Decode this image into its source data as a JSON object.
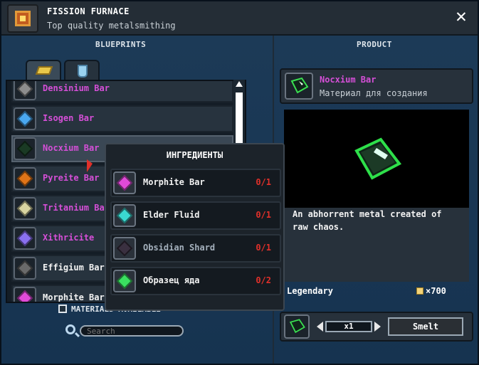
{
  "window": {
    "title": "FISSION FURNACE",
    "subtitle": "Top quality metalsmithing",
    "close_icon": "close-icon"
  },
  "sections": {
    "blueprints": "BLUEPRINTS",
    "product": "PRODUCT"
  },
  "tabs": [
    {
      "icon": "ingot-icon",
      "active": true
    },
    {
      "icon": "flask-icon",
      "active": false
    }
  ],
  "blueprints": [
    {
      "label": "Densinium Bar",
      "color": "#d64fd8",
      "gem": "#8d8d8d"
    },
    {
      "label": "Isogen Bar",
      "color": "#d64fd8",
      "gem": "#4aa8f0"
    },
    {
      "label": "Nocxium Bar",
      "color": "#d64fd8",
      "gem": "#1a3a24",
      "selected": true
    },
    {
      "label": "Pyreite Bar",
      "color": "#d64fd8",
      "gem": "#e07418"
    },
    {
      "label": "Tritanium Bar",
      "color": "#d64fd8",
      "gem": "#d8d4a0"
    },
    {
      "label": "Xithricite",
      "color": "#d64fd8",
      "gem": "#8a70f0"
    },
    {
      "label": "Effigium Bar",
      "color": "#f2f2f2",
      "gem": "#6a6a6a"
    },
    {
      "label": "Morphite Bar",
      "color": "#f2f2f2",
      "gem": "#e04ad8"
    }
  ],
  "filter": {
    "materials_available": "MATERIALS AVAILABLE"
  },
  "search": {
    "placeholder": "Search"
  },
  "ingredients": {
    "title": "ИНГРЕДИЕНТЫ",
    "items": [
      {
        "name": "Morphite Bar",
        "count": "0/1",
        "gem": "#e04ad8",
        "dim": false
      },
      {
        "name": "Elder Fluid",
        "count": "0/1",
        "gem": "#3ad8d0",
        "dim": false
      },
      {
        "name": "Obsidian Shard",
        "count": "0/1",
        "gem": "#3a3040",
        "dim": true
      },
      {
        "name": "Образец яда",
        "count": "0/2",
        "gem": "#3ae060",
        "dim": false
      }
    ]
  },
  "product": {
    "name": "Nocxium Bar",
    "type": "Материал для создания",
    "description": "An abhorrent metal created of raw chaos.",
    "rarity": "Legendary",
    "price": "×700",
    "quantity": "x1",
    "smelt_label": "Smelt"
  },
  "colors": {
    "accent_pink": "#d64fd8",
    "missing_red": "#e0302a",
    "panel_blue": "#1c3a57"
  }
}
